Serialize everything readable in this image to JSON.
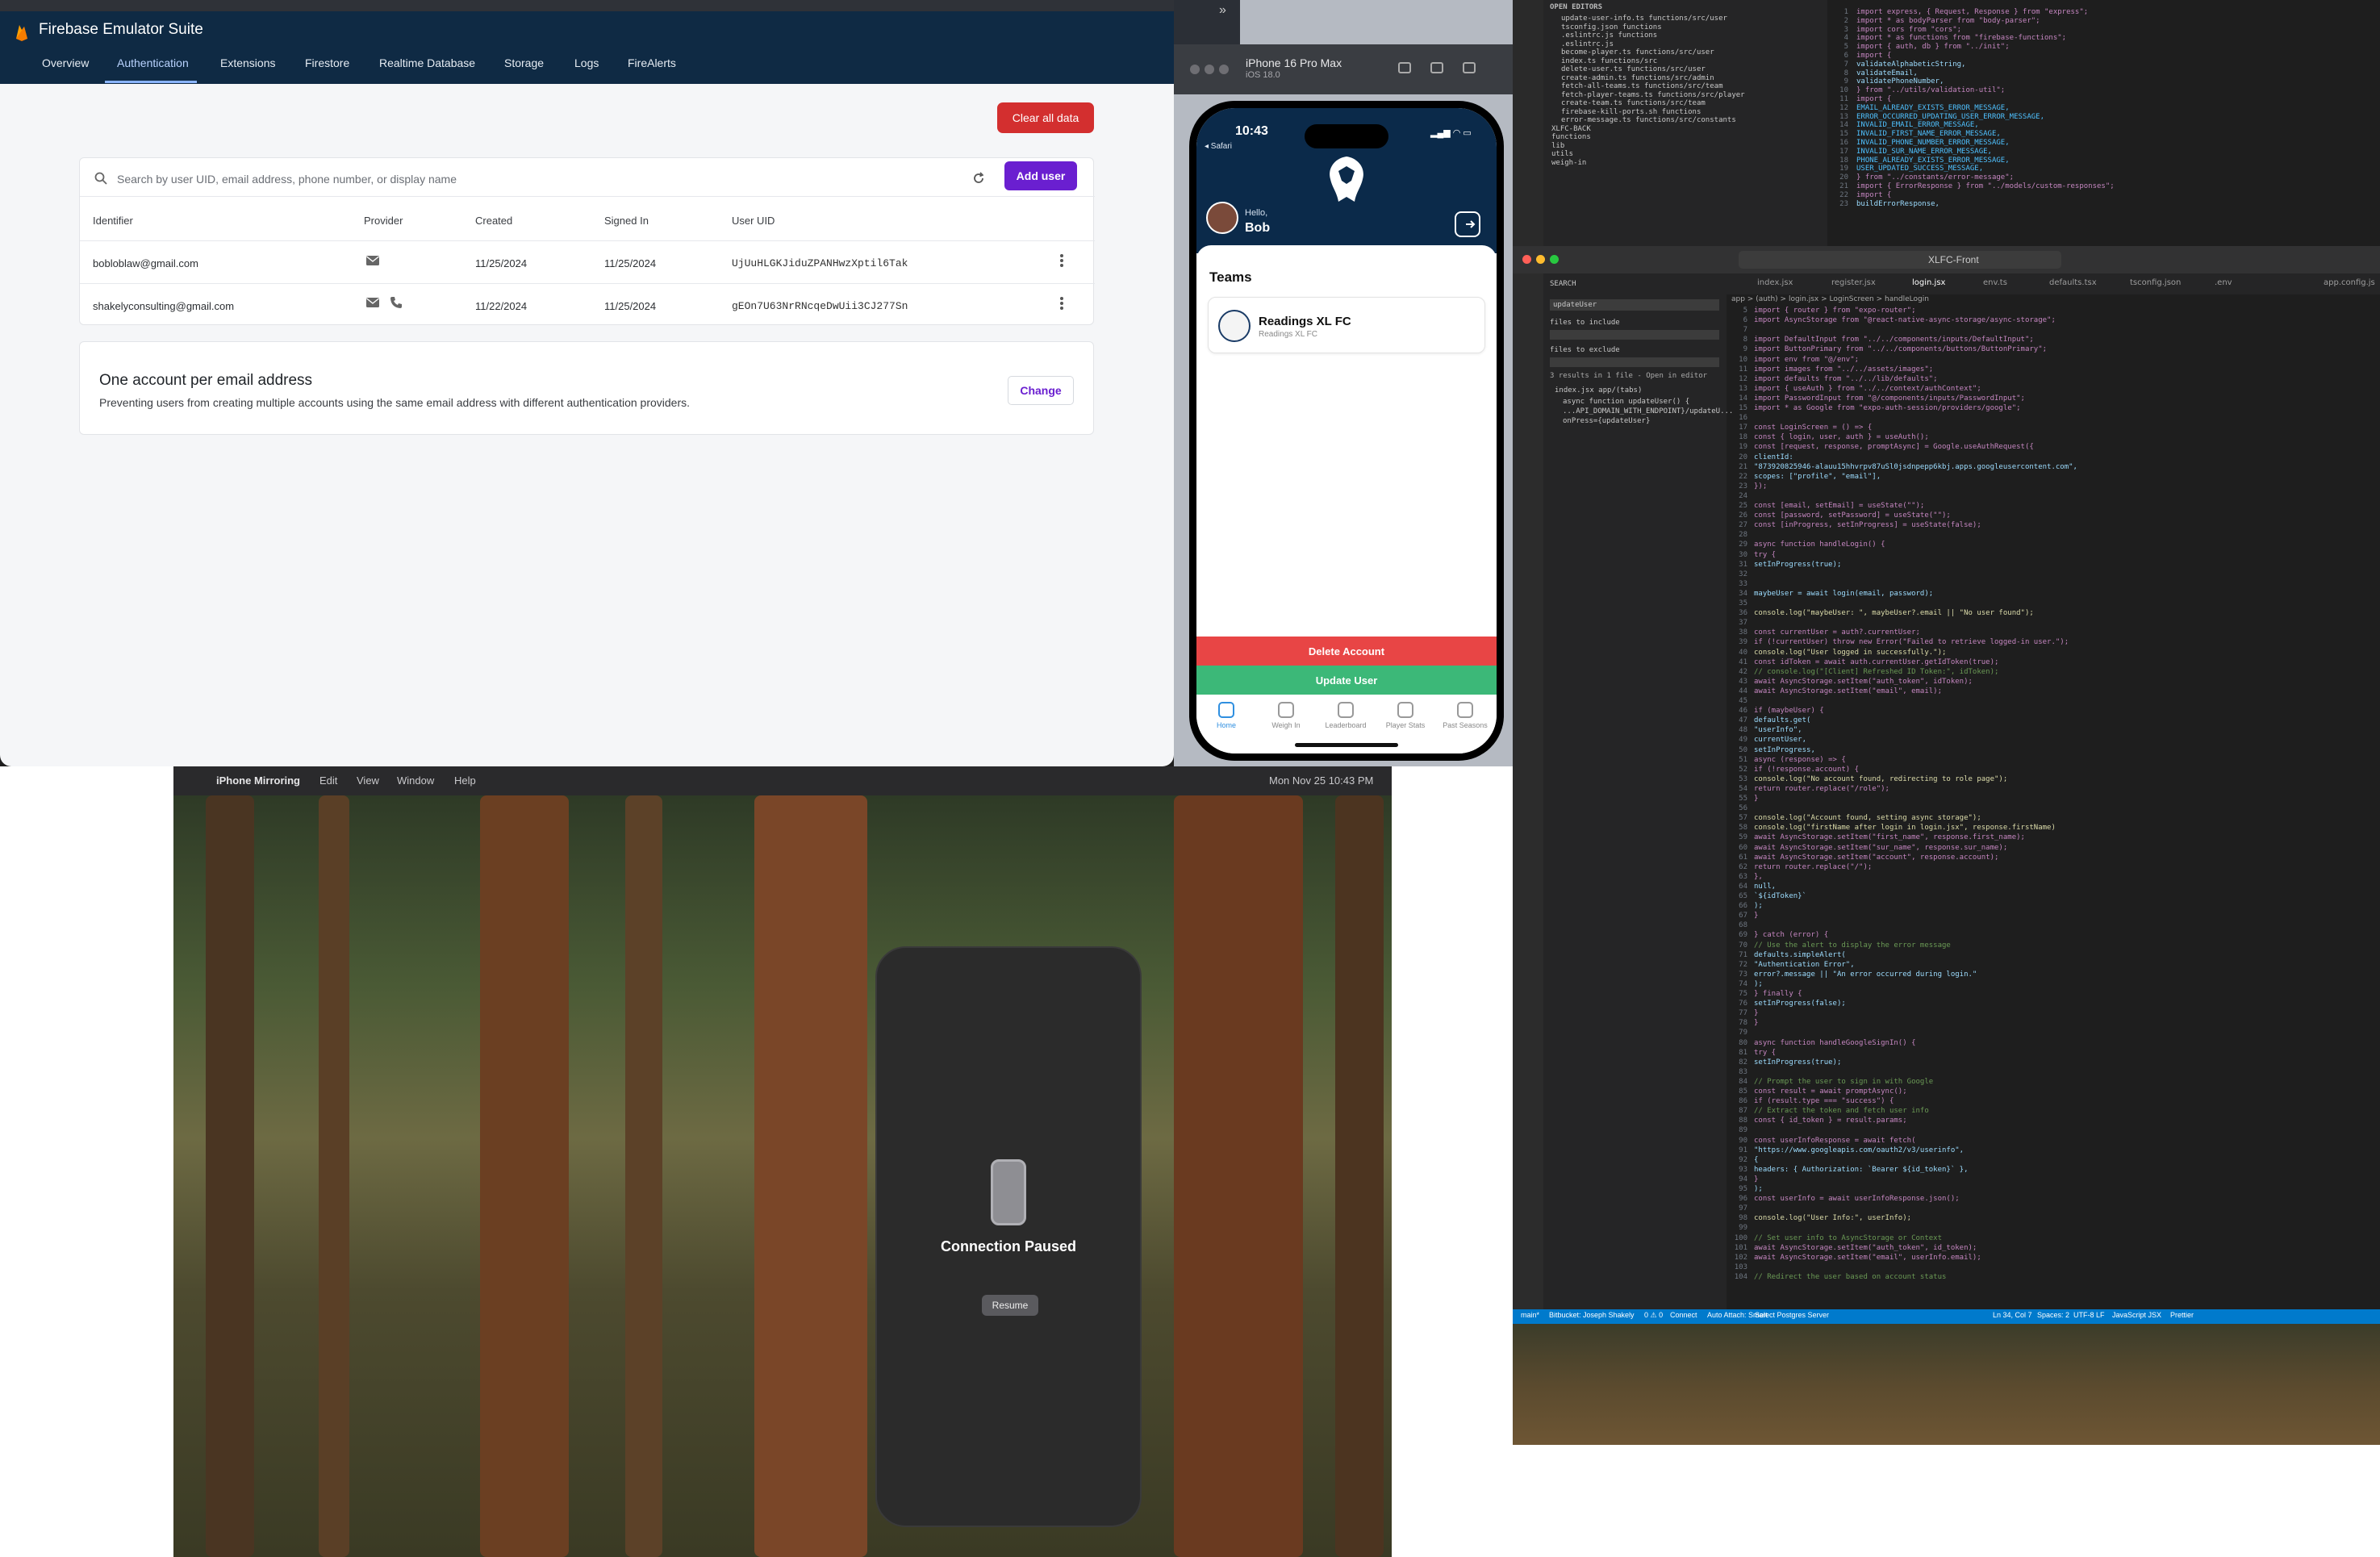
{
  "firebase": {
    "title": "Firebase Emulator Suite",
    "tabs": [
      "Overview",
      "Authentication",
      "Extensions",
      "Firestore",
      "Realtime Database",
      "Storage",
      "Logs",
      "FireAlerts"
    ],
    "clear_all": "Clear all data",
    "search_placeholder": "Search by user UID, email address, phone number, or display name",
    "add_user": "Add user",
    "columns": [
      "Identifier",
      "Provider",
      "Created",
      "Signed In",
      "User UID"
    ],
    "rows": [
      {
        "identifier": "bobloblaw@gmail.com",
        "created": "11/25/2024",
        "signed_in": "11/25/2024",
        "uid": "UjUuHLGKJiduZPANHwzXptil6Tak"
      },
      {
        "identifier": "shakelyconsulting@gmail.com",
        "created": "11/22/2024",
        "signed_in": "11/25/2024",
        "uid": "gEOn7U63NrRNcqeDwUii3CJ277Sn"
      }
    ],
    "account_title": "One account per email address",
    "account_desc": "Preventing users from creating multiple accounts using the same email address with different authentication providers.",
    "change": "Change"
  },
  "simulator": {
    "device": "iPhone 16 Pro Max",
    "os": "iOS 18.0",
    "time": "10:43",
    "back": "◂ Safari",
    "hello": "Hello,",
    "name": "Bob",
    "teams_label": "Teams",
    "team_name": "Readings XL FC",
    "team_sub": "Readings XL FC",
    "delete_account": "Delete Account",
    "update_user": "Update User",
    "nav": [
      "Home",
      "Weigh In",
      "Leaderboard",
      "Player Stats",
      "Past Seasons"
    ]
  },
  "mirroring": {
    "menu": [
      "iPhone Mirroring",
      "Edit",
      "View",
      "Window",
      "Help"
    ],
    "clock": "Mon Nov 25  10:43 PM",
    "paused": "Connection Paused",
    "resume": "Resume"
  },
  "vscode_top": {
    "open_editors": "OPEN EDITORS",
    "files": [
      "update-user-info.ts functions/src/user",
      "tsconfig.json functions",
      ".eslintrc.js functions",
      ".eslintrc.js",
      "become-player.ts functions/src/user",
      "index.ts functions/src",
      "delete-user.ts functions/src/user",
      "create-admin.ts functions/src/admin",
      "fetch-all-teams.ts functions/src/team",
      "fetch-player-teams.ts functions/src/player",
      "create-team.ts functions/src/team",
      "firebase-kill-ports.sh functions",
      "error-message.ts functions/src/constants",
      "XLFC-BACK",
      "functions",
      "lib",
      "utils",
      "weigh-in"
    ],
    "code": [
      "import express, { Request, Response } from \"express\";",
      "import * as bodyParser from \"body-parser\";",
      "import cors from \"cors\";",
      "import * as functions from \"firebase-functions\";",
      "import { auth, db } from \"../init\";",
      "import {",
      "  validateAlphabeticString,",
      "  validateEmail,",
      "  validatePhoneNumber,",
      "} from \"../utils/validation-util\";",
      "import {",
      "  EMAIL_ALREADY_EXISTS_ERROR_MESSAGE,",
      "  ERROR_OCCURRED_UPDATING_USER_ERROR_MESSAGE,",
      "  INVALID_EMAIL_ERROR_MESSAGE,",
      "  INVALID_FIRST_NAME_ERROR_MESSAGE,",
      "  INVALID_PHONE_NUMBER_ERROR_MESSAGE,",
      "  INVALID_SUR_NAME_ERROR_MESSAGE,",
      "  PHONE_ALREADY_EXISTS_ERROR_MESSAGE,",
      "  USER_UPDATED_SUCCESS_MESSAGE,",
      "} from \"../constants/error-message\";",
      "import { ErrorResponse } from \"../models/custom-responses\";",
      "import {",
      "  buildErrorResponse,"
    ]
  },
  "vscode_main": {
    "window_title": "XLFC-Front",
    "tabs": [
      "index.jsx",
      "register.jsx",
      "login.jsx",
      "env.ts",
      "defaults.tsx",
      "tsconfig.json",
      ".env",
      "app.config.js"
    ],
    "search_label": "SEARCH",
    "search_query": "updateUser",
    "files_include": "files to include",
    "files_exclude": "files to exclude",
    "results": "3 results in 1 file - Open in editor",
    "result_file": "index.jsx app/(tabs)",
    "result_1": "async function updateUser() {",
    "result_2": "...API_DOMAIN_WITH_ENDPOINT}/updateU...",
    "result_3": "onPress={updateUser}",
    "breadcrumb": "app > (auth) > login.jsx > LoginScreen > handleLogin",
    "code": [
      "import { router } from \"expo-router\";",
      "import AsyncStorage from \"@react-native-async-storage/async-storage\";",
      "",
      "import DefaultInput from \"../../components/inputs/DefaultInput\";",
      "import ButtonPrimary from \"../../components/buttons/ButtonPrimary\";",
      "import env from \"@/env\";",
      "import images from \"../../assets/images\";",
      "import defaults from \"../../lib/defaults\";",
      "import { useAuth } from \"../../context/authContext\";",
      "import PasswordInput from \"@/components/inputs/PasswordInput\";",
      "import * as Google from \"expo-auth-session/providers/google\";",
      "",
      "const LoginScreen = () => {",
      "  const { login, user, auth } = useAuth();",
      "  const [request, response, promptAsync] = Google.useAuthRequest({",
      "    clientId:",
      "      \"873920825946-alauu15hhvrpv87uSl0jsdnpepp6kbj.apps.googleusercontent.com\",",
      "    scopes: [\"profile\", \"email\"],",
      "  });",
      "",
      "  const [email, setEmail] = useState(\"\");",
      "  const [password, setPassword] = useState(\"\");",
      "  const [inProgress, setInProgress] = useState(false);",
      "",
      "  async function handleLogin() {",
      "    try {",
      "      setInProgress(true);",
      "",
      "",
      "      maybeUser = await login(email, password);",
      "",
      "      console.log(\"maybeUser: \", maybeUser?.email || \"No user found\");",
      "",
      "      const currentUser = auth?.currentUser;",
      "      if (!currentUser) throw new Error(\"Failed to retrieve logged-in user.\");",
      "      console.log(\"User logged in successfully.\");",
      "      const idToken = await auth.currentUser.getIdToken(true);",
      "      // console.log(\"[Client] Refreshed ID Token:\", idToken);",
      "      await AsyncStorage.setItem(\"auth_token\", idToken);",
      "      await AsyncStorage.setItem(\"email\", email);",
      "",
      "      if (maybeUser) {",
      "        defaults.get(",
      "          \"userInfo\",",
      "          currentUser,",
      "          setInProgress,",
      "          async (response) => {",
      "            if (!response.account) {",
      "              console.log(\"No account found, redirecting to role page\");",
      "              return router.replace(\"/role\");",
      "            }",
      "",
      "            console.log(\"Account found, setting async storage\");",
      "            console.log(\"firstName after login in login.jsx\", response.firstName)",
      "            await AsyncStorage.setItem(\"first_name\", response.first_name);",
      "            await AsyncStorage.setItem(\"sur_name\", response.sur_name);",
      "            await AsyncStorage.setItem(\"account\", response.account);",
      "            return router.replace(\"/\");",
      "          },",
      "          null,",
      "          `${idToken}`",
      "        );",
      "      }",
      "",
      "    } catch (error) {",
      "      // Use the alert to display the error message",
      "      defaults.simpleAlert(",
      "        \"Authentication Error\",",
      "        error?.message || \"An error occurred during login.\"",
      "      );",
      "    } finally {",
      "      setInProgress(false);",
      "    }",
      "  }",
      "",
      "  async function handleGoogleSignIn() {",
      "    try {",
      "      setInProgress(true);",
      "",
      "      // Prompt the user to sign in with Google",
      "      const result = await promptAsync();",
      "      if (result.type === \"success\") {",
      "        // Extract the token and fetch user info",
      "        const { id_token } = result.params;",
      "",
      "        const userInfoResponse = await fetch(",
      "          \"https://www.googleapis.com/oauth2/v3/userinfo\",",
      "          {",
      "            headers: { Authorization: `Bearer ${id_token}` },",
      "          }",
      "        );",
      "        const userInfo = await userInfoResponse.json();",
      "",
      "        console.log(\"User Info:\", userInfo);",
      "",
      "        // Set user info to AsyncStorage or Context",
      "        await AsyncStorage.setItem(\"auth_token\", id_token);",
      "        await AsyncStorage.setItem(\"email\", userInfo.email);",
      "",
      "        // Redirect the user based on account status"
    ],
    "status": [
      "main*",
      "Bitbucket: Joseph Shakely",
      "0 ⚠ 0",
      "Connect",
      "Auto Attach: Smart",
      "Select Postgres Server",
      "Ln 34, Col 7",
      "Spaces: 2",
      "UTF-8",
      "LF",
      "JavaScript JSX",
      "Prettier"
    ]
  },
  "colors": {
    "firebase_header": "#0f2a44",
    "accent": "#6a1fd0",
    "danger": "#d32f2f",
    "vscode_status": "#007acc"
  }
}
